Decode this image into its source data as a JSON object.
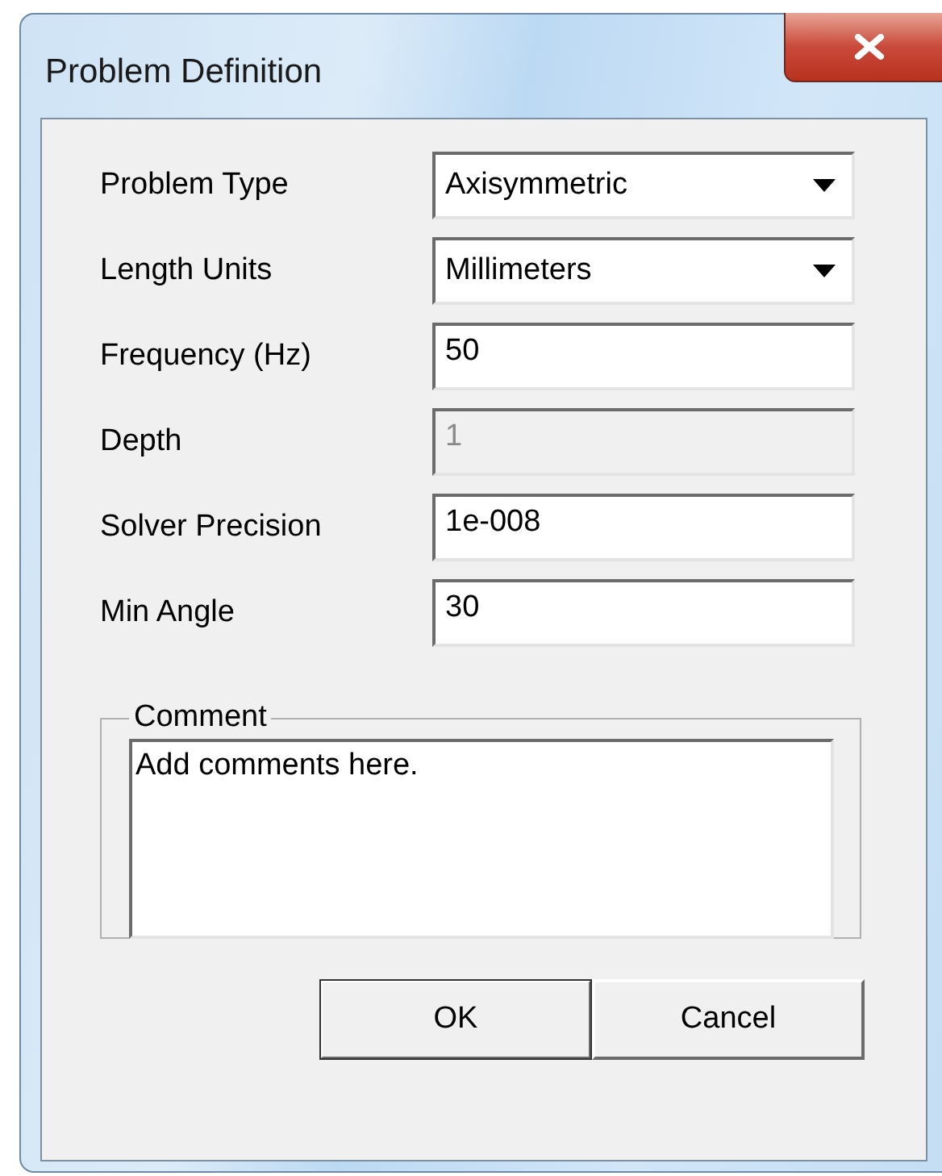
{
  "window": {
    "title": "Problem Definition"
  },
  "fields": [
    {
      "kind": "dropdown",
      "label": "Problem Type",
      "value": "Axisymmetric",
      "disabled": false
    },
    {
      "kind": "dropdown",
      "label": "Length Units",
      "value": "Millimeters",
      "disabled": false
    },
    {
      "kind": "text",
      "label": "Frequency (Hz)",
      "value": "50",
      "disabled": false
    },
    {
      "kind": "text",
      "label": "Depth",
      "value": "1",
      "disabled": true
    },
    {
      "kind": "text",
      "label": "Solver Precision",
      "value": "1e-008",
      "disabled": false
    },
    {
      "kind": "text",
      "label": "Min Angle",
      "value": "30",
      "disabled": false
    }
  ],
  "comment": {
    "label": "Comment",
    "value": "Add comments here."
  },
  "buttons": [
    "OK",
    "Cancel"
  ]
}
